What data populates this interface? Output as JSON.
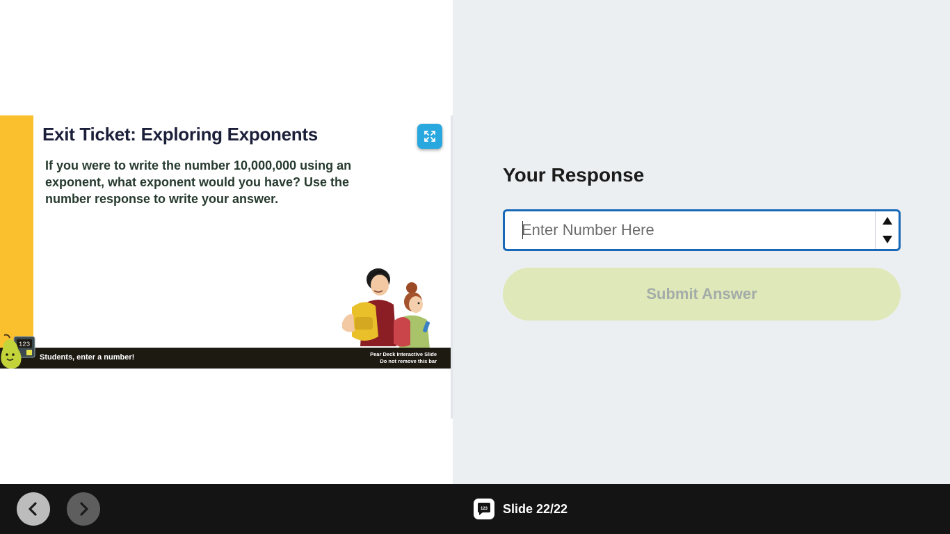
{
  "slide": {
    "title": "Exit Ticket: Exploring Exponents",
    "body": "If you were to write the number 10,000,000 using an exponent, what exponent would you have? Use the number response to write your answer.",
    "footer_text": "Students, enter a number!",
    "footer_note_line1": "Pear Deck Interactive Slide",
    "footer_note_line2": "Do not remove this bar",
    "logo_text": "123"
  },
  "response": {
    "heading": "Your Response",
    "input_placeholder": "Enter Number Here",
    "input_value": "",
    "submit_label": "Submit Answer"
  },
  "bottom_bar": {
    "slide_icon_text": "123",
    "slide_counter": "Slide 22/22"
  },
  "icons": {
    "expand": "expand-icon",
    "prev": "chevron-left-icon",
    "next": "chevron-right-icon",
    "slide_type": "number-response-icon",
    "spin_up": "triangle-up-icon",
    "spin_down": "triangle-down-icon"
  },
  "colors": {
    "accent_yellow": "#fbc02d",
    "expand_blue": "#29a8e0",
    "input_border": "#1868b7",
    "submit_bg": "#dfe8b8",
    "right_panel_bg": "#ebeff2",
    "bottom_bar_bg": "#141414"
  }
}
